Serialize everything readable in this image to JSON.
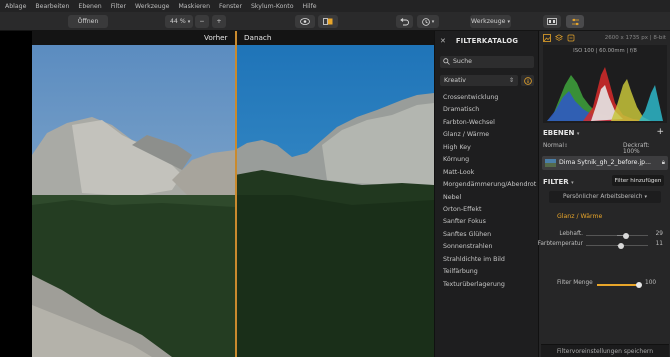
{
  "menu": [
    "Ablage",
    "Bearbeiten",
    "Ebenen",
    "Filter",
    "Werkzeuge",
    "Maskieren",
    "Fenster",
    "Skylum-Konto",
    "Hilfe"
  ],
  "toolbar": {
    "open_label": "Öffnen",
    "zoom_label": "44 %",
    "zoom_minus": "−",
    "zoom_plus": "+",
    "tools_label": "Werkzeuge"
  },
  "compare": {
    "before": "Vorher",
    "after": "Danach",
    "split_fraction": 0.5
  },
  "catalog": {
    "title": "FILTERKATALOG",
    "close": "✕",
    "search_placeholder": "Suche",
    "category": "Kreativ",
    "filters": [
      "Crossentwicklung",
      "Dramatisch",
      "Farbton-Wechsel",
      "Glanz / Wärme",
      "High Key",
      "Körnung",
      "Matt-Look",
      "Morgendämmerung/Abendrot",
      "Nebel",
      "Orton-Effekt",
      "Sanfter Fokus",
      "Sanftes Glühen",
      "Sonnenstrahlen",
      "Strahldichte im Bild",
      "Teilfärbung",
      "Texturüberlagerung"
    ]
  },
  "panel": {
    "image_meta": "2600 x 1735 px  |  8-bit",
    "histogram_info": "ISO 100  |  60.00mm  |  f/8",
    "layers_title": "EBENEN",
    "layers_plus": "+",
    "blend_mode": "Normal",
    "opacity_label": "Deckraft: 100%",
    "layer_name": "Dima Sytnik_gh_2_before.jp...",
    "filter_title": "FILTER",
    "filter_add": "Filter hinzufügen",
    "workspace": "Persönlicher Arbeitsbereich",
    "active_filter": "Glanz / Wärme",
    "sliders": [
      {
        "label": "Lebhaft.",
        "value": "29",
        "fraction": 0.64
      },
      {
        "label": "Farbtemperatur",
        "value": "11",
        "fraction": 0.56
      }
    ],
    "amount": {
      "label": "Filter Menge",
      "value": "100",
      "fraction": 1.0
    },
    "save_label": "Filtervoreinstellungen speichern"
  },
  "colors": {
    "accent": "#e8a52a",
    "splitter": "#c98a2e"
  }
}
